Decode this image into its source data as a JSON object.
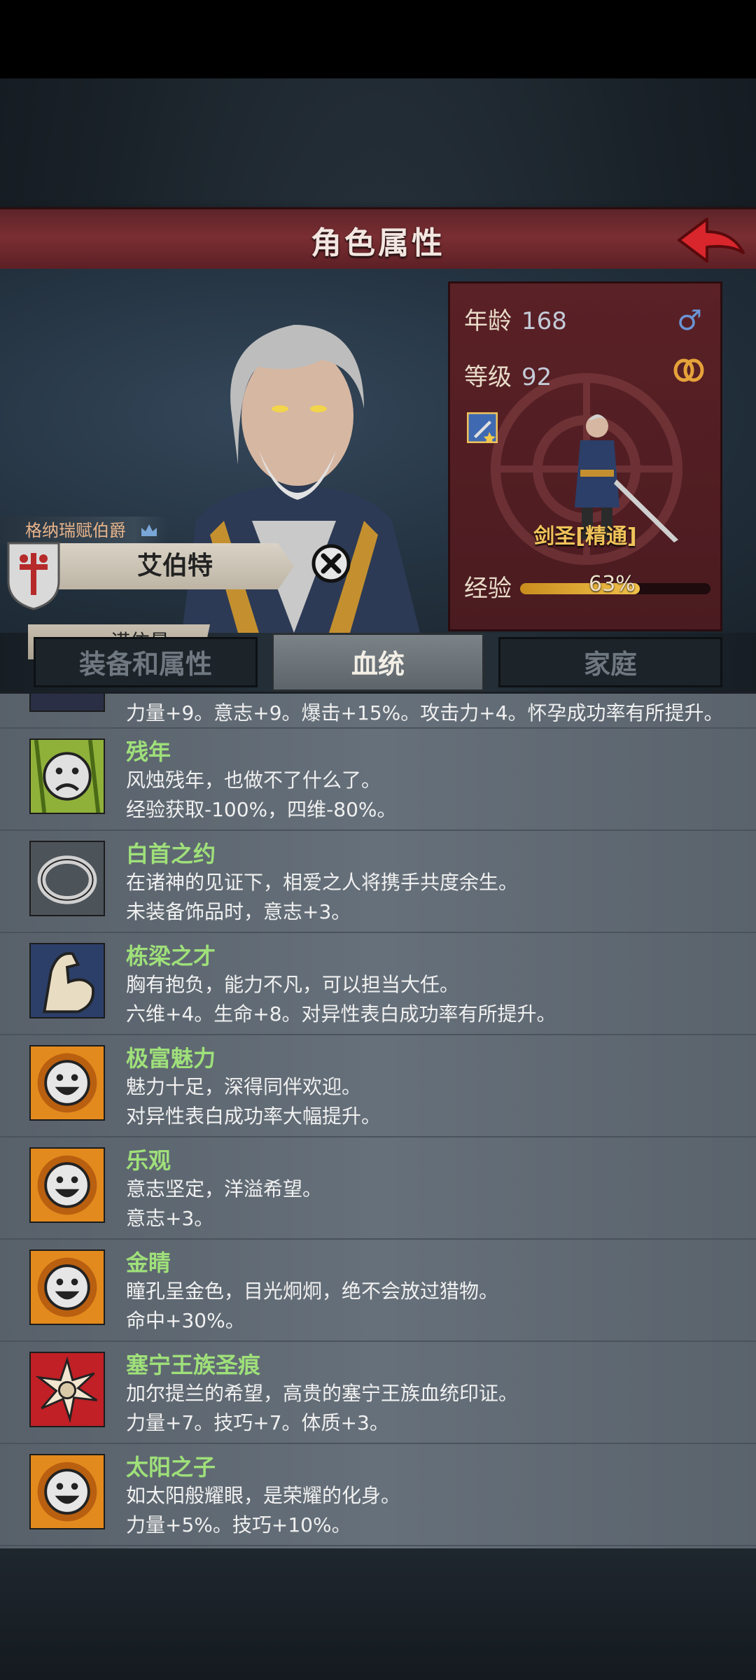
{
  "header": {
    "title": "角色属性"
  },
  "character": {
    "noble_title": "格纳瑞赋伯爵",
    "name": "艾伯特",
    "surname": "诺依曼"
  },
  "stats": {
    "age_label": "年龄",
    "age": "168",
    "level_label": "等级",
    "level": "92",
    "class_name": "剑圣[精通]",
    "exp_label": "经验",
    "exp_percent": "63%",
    "exp_fraction": 0.63
  },
  "tabs": [
    {
      "label": "装备和属性"
    },
    {
      "label": "血统"
    },
    {
      "label": "家庭"
    }
  ],
  "traits_partial": {
    "desc2": "力量+9。意志+9。爆击+15%。攻击力+4。怀孕成功率有所提升。"
  },
  "traits": [
    {
      "name": "残年",
      "desc1": "风烛残年，也做不了什么了。",
      "desc2": "经验获取-100%，四维-80%。",
      "icon": "sad-face-icon"
    },
    {
      "name": "白首之约",
      "desc1": "在诸神的见证下，相爱之人将携手共度余生。",
      "desc2": "未装备饰品时，意志+3。",
      "icon": "ring-icon"
    },
    {
      "name": "栋梁之才",
      "desc1": "胸有抱负，能力不凡，可以担当大任。",
      "desc2": "六维+4。生命+8。对异性表白成功率有所提升。",
      "icon": "flexed-arm-icon"
    },
    {
      "name": "极富魅力",
      "desc1": "魅力十足，深得同伴欢迎。",
      "desc2": "对异性表白成功率大幅提升。",
      "icon": "happy-face-icon"
    },
    {
      "name": "乐观",
      "desc1": "意志坚定，洋溢希望。",
      "desc2": "意志+3。",
      "icon": "happy-face-icon"
    },
    {
      "name": "金睛",
      "desc1": "瞳孔呈金色，目光炯炯，绝不会放过猎物。",
      "desc2": "命中+30%。",
      "icon": "happy-face-icon"
    },
    {
      "name": "塞宁王族圣痕",
      "desc1": "加尔提兰的希望，高贵的塞宁王族血统印证。",
      "desc2": "力量+7。技巧+7。体质+3。",
      "icon": "royal-sun-emblem-icon"
    },
    {
      "name": "太阳之子",
      "desc1": "如太阳般耀眼，是荣耀的化身。",
      "desc2": "力量+5%。技巧+10%。",
      "icon": "happy-face-icon"
    }
  ]
}
